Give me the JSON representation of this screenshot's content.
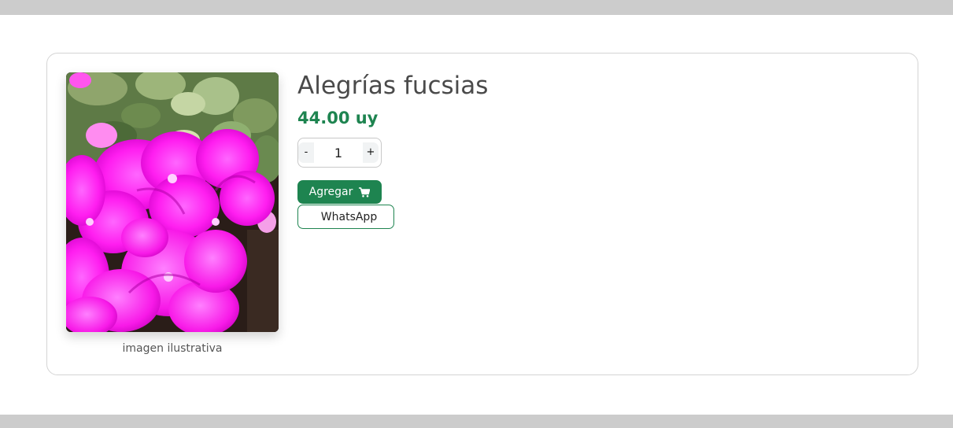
{
  "product": {
    "name": "Alegrías fucsias",
    "price": "44.00 uy",
    "image_caption": "imagen ilustrativa",
    "image_subject": "fuchsia impatiens flowers with green leaves"
  },
  "quantity": {
    "decrement_label": "-",
    "value": "1",
    "increment_label": "+"
  },
  "actions": {
    "add_label": "Agregar",
    "add_icon": "cart-icon",
    "whatsapp_label": "WhatsApp"
  },
  "colors": {
    "accent": "#1e8450",
    "title": "#4a4a4a",
    "bars": "#cccccc",
    "card_border": "#d4d4d4"
  }
}
